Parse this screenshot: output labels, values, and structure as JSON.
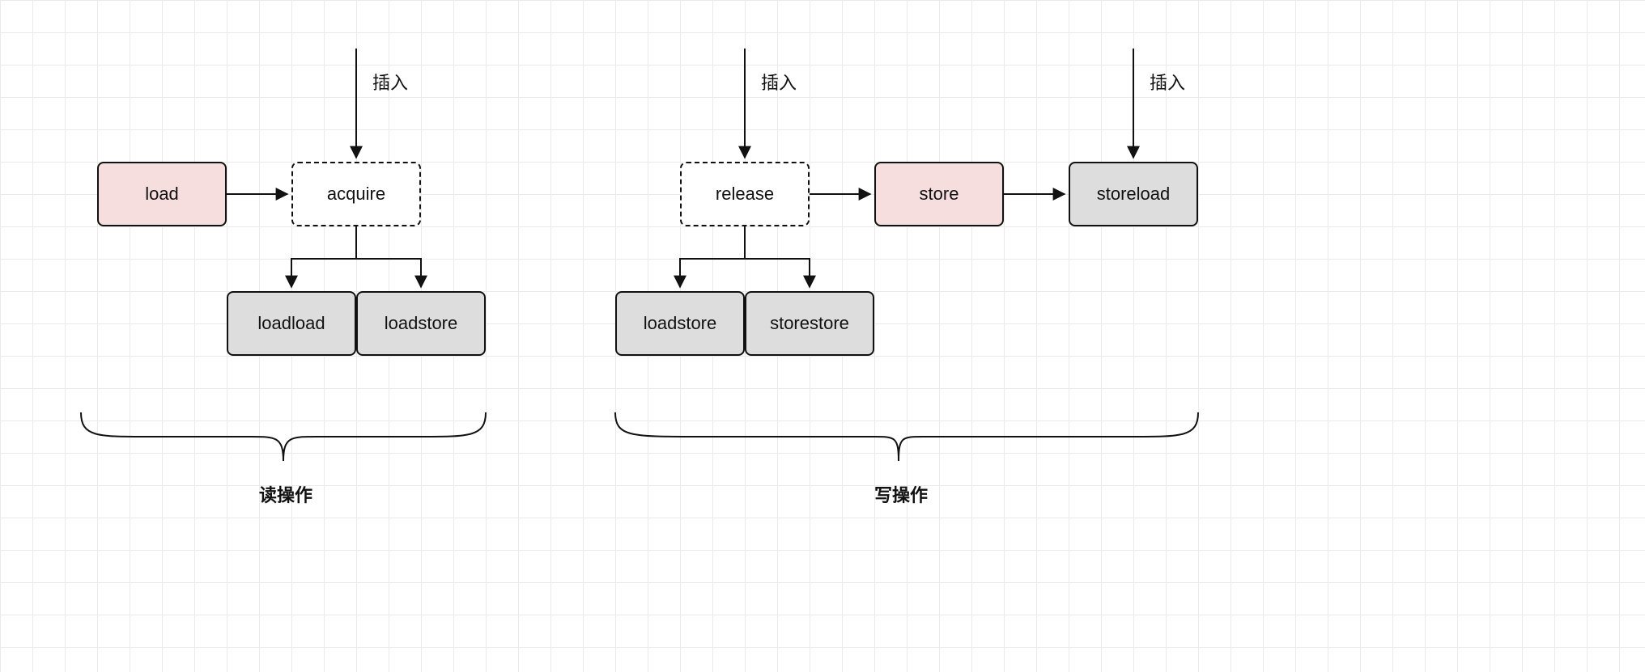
{
  "left": {
    "insert_label": "插入",
    "load": "load",
    "acquire": "acquire",
    "loadload": "loadload",
    "loadstore": "loadstore",
    "caption": "读操作"
  },
  "right": {
    "insert_label_1": "插入",
    "insert_label_2": "插入",
    "release": "release",
    "store": "store",
    "storeload": "storeload",
    "loadstore": "loadstore",
    "storestore": "storestore",
    "caption": "写操作"
  }
}
